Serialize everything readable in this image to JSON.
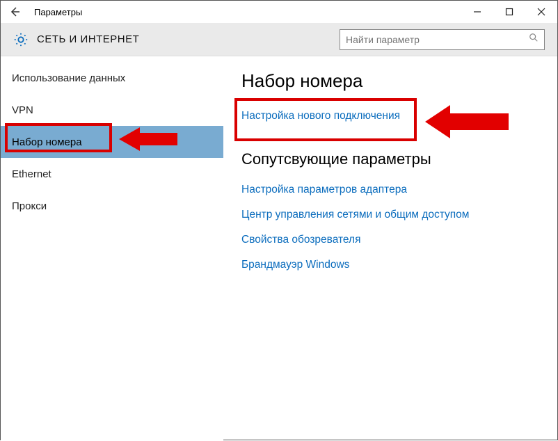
{
  "window": {
    "title": "Параметры"
  },
  "header": {
    "title": "СЕТЬ И ИНТЕРНЕТ",
    "search_placeholder": "Найти параметр"
  },
  "sidebar": {
    "items": [
      {
        "label": "Использование данных",
        "selected": false
      },
      {
        "label": "VPN",
        "selected": false
      },
      {
        "label": "Набор номера",
        "selected": true
      },
      {
        "label": "Ethernet",
        "selected": false
      },
      {
        "label": "Прокси",
        "selected": false
      }
    ]
  },
  "main": {
    "heading": "Набор номера",
    "primary_link": "Настройка нового подключения",
    "related_heading": "Сопутсвующие параметры",
    "related_links": [
      "Настройка параметров адаптера",
      "Центр управления сетями и общим доступом",
      "Свойства обозревателя",
      "Брандмауэр Windows"
    ]
  }
}
